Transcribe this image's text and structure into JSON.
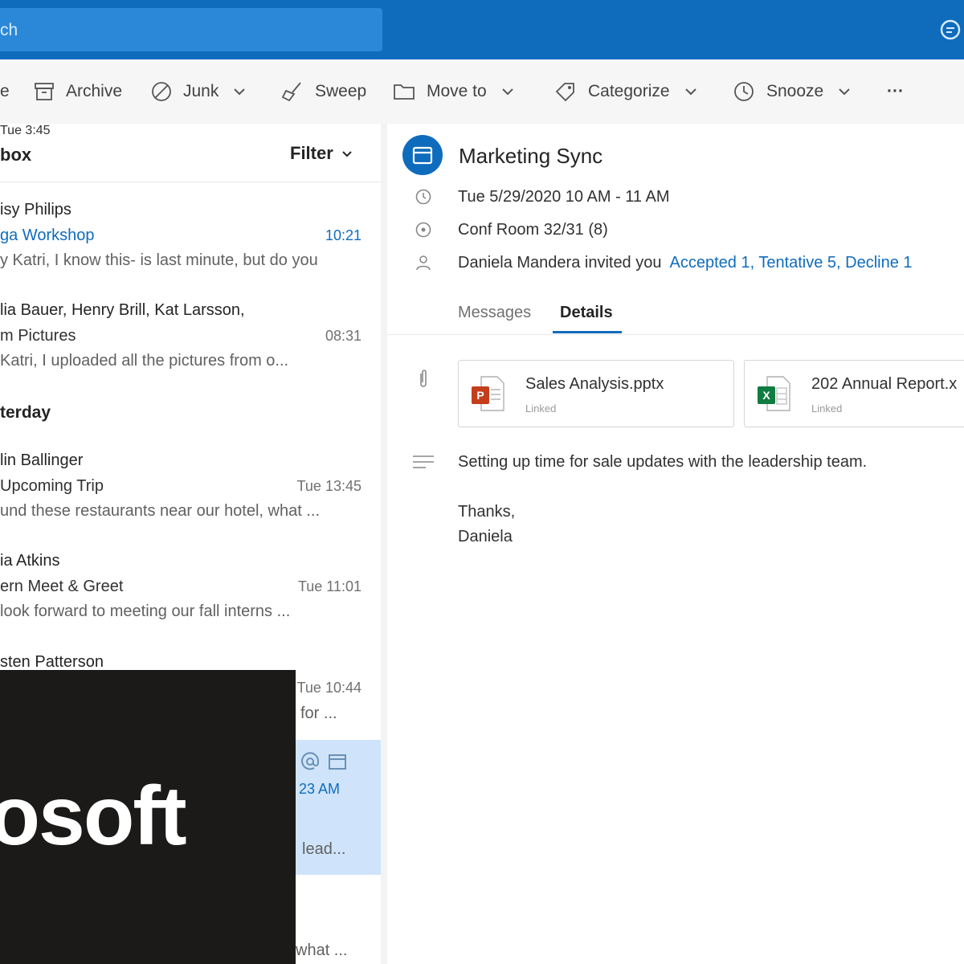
{
  "search": {
    "placeholder_visible": "ch"
  },
  "toolbar": {
    "delete_partial": "e",
    "archive": "Archive",
    "junk": "Junk",
    "sweep": "Sweep",
    "move_to": "Move to",
    "categorize": "Categorize",
    "snooze": "Snooze",
    "more": "···"
  },
  "list": {
    "title": "box",
    "filter": "Filter",
    "yesterday_header": "terday",
    "messages": [
      {
        "sender": "isy Philips",
        "subject": "ga Workshop",
        "preview": "y Katri, I know this- is last minute, but do you",
        "time": "10:21"
      },
      {
        "sender": "lia Bauer, Henry Brill, Kat Larsson,",
        "subject": "m Pictures",
        "preview": "Katri, I uploaded all the pictures from o...",
        "time": "08:31"
      },
      {
        "sender": "lin Ballinger",
        "subject": "Upcoming Trip",
        "preview": "und these restaurants near our hotel, what ...",
        "time": "Tue 13:45"
      },
      {
        "sender": "ia Atkins",
        "subject": "ern Meet & Greet",
        "preview": "look forward to meeting our fall interns ...",
        "time": "Tue 11:01"
      },
      {
        "sender": "sten Patterson",
        "preview": "for ...",
        "time": "Tue 10:44"
      }
    ],
    "selected": {
      "time": "23 AM",
      "preview": "lead..."
    },
    "last": {
      "time": "Tue 3:45",
      "preview": "what ..."
    }
  },
  "event": {
    "title": "Marketing Sync",
    "when": "Tue 5/29/2020 10 AM - 11 AM",
    "where": "Conf Room 32/31 (8)",
    "invited": "Daniela Mandera invited you",
    "responses": "Accepted 1, Tentative 5, Decline 1",
    "tabs": {
      "messages": "Messages",
      "details": "Details"
    },
    "attachments": [
      {
        "name": "Sales Analysis.pptx",
        "status": "Linked"
      },
      {
        "name": "202 Annual Report.x",
        "status": "Linked"
      }
    ],
    "body": {
      "line1": "Setting up time for sale updates with the leadership team.",
      "line2": "Thanks,",
      "line3": "Daniela"
    }
  },
  "brand": {
    "text": "rosoft"
  },
  "colors": {
    "accent": "#0f6cbd",
    "selected_row": "#cfe4fa",
    "ppt": "#c43e1c",
    "excel": "#107c41"
  }
}
